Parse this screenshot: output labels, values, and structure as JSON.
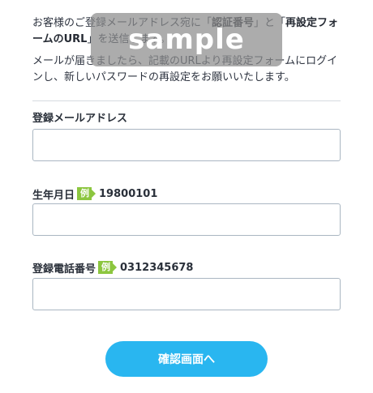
{
  "intro": {
    "p1_a": "お客様のご登録メールアドレス宛に「",
    "p1_b": "認証番号",
    "p1_c": "」と「",
    "p1_d": "再設定フォームのURL",
    "p1_e": "」を送信します。",
    "p2": "メールが届きましたら、記載のURLより再設定フォームにログインし、新しいパスワードの再設定をお願いいたします。"
  },
  "form": {
    "email": {
      "label": "登録メールアドレス",
      "value": ""
    },
    "birthdate": {
      "label": "生年月日",
      "example_badge": "例",
      "example": "19800101",
      "value": ""
    },
    "phone": {
      "label": "登録電話番号",
      "example_badge": "例",
      "example": "0312345678",
      "value": ""
    }
  },
  "submit": {
    "label": "確認画面へ"
  },
  "watermark": {
    "text": "sample"
  },
  "colors": {
    "button": "#29b6f0",
    "example_badge": "#8cc63f",
    "input_border": "#aab6c2"
  }
}
